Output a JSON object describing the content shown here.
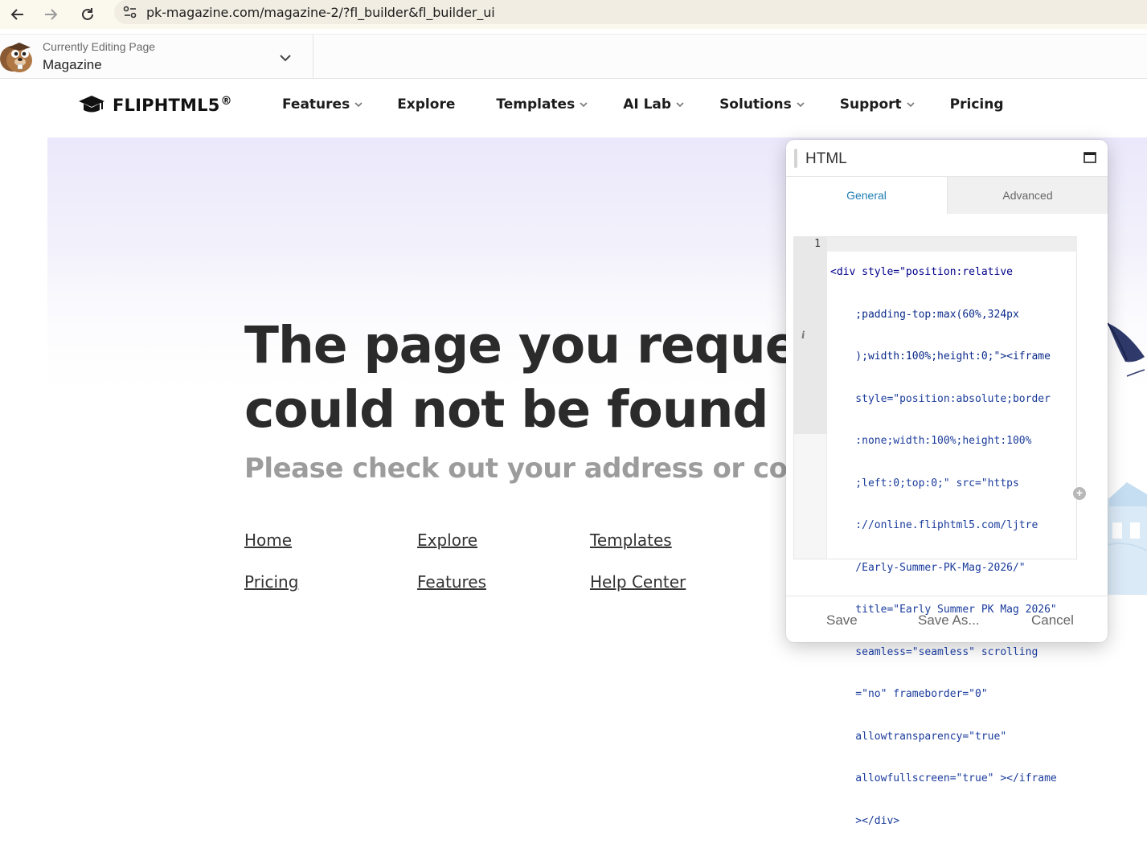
{
  "browser": {
    "url": "pk-magazine.com/magazine-2/?fl_builder&fl_builder_ui"
  },
  "builder_bar": {
    "label": "Currently Editing Page",
    "page_name": "Magazine"
  },
  "site": {
    "brand": "FLIPHTML5",
    "brand_mark": "®",
    "nav": [
      {
        "label": "Features",
        "has_dropdown": true
      },
      {
        "label": "Explore",
        "has_dropdown": false
      },
      {
        "label": "Templates",
        "has_dropdown": true
      },
      {
        "label": "AI Lab",
        "has_dropdown": true
      },
      {
        "label": "Solutions",
        "has_dropdown": true
      },
      {
        "label": "Support",
        "has_dropdown": true
      },
      {
        "label": "Pricing",
        "has_dropdown": false
      }
    ]
  },
  "hero": {
    "headline_line1": "The page you requested",
    "headline_line2": "could not be found",
    "subline": "Please check out your address or contact us",
    "links": [
      "Home",
      "Explore",
      "Templates",
      "Pricing",
      "Features",
      "Help Center"
    ]
  },
  "panel": {
    "title": "HTML",
    "tabs": [
      {
        "label": "General",
        "active": true
      },
      {
        "label": "Advanced",
        "active": false
      }
    ],
    "line_number": "1",
    "code_lines": [
      "<div style=\"position:relative",
      "    ;padding-top:max(60%,324px",
      "    );width:100%;height:0;\"><iframe",
      "    style=\"position:absolute;border",
      "    :none;width:100%;height:100%",
      "    ;left:0;top:0;\" src=\"https",
      "    ://online.fliphtml5.com/ljtre",
      "    /Early-Summer-PK-Mag-2026/\"",
      "    title=\"Early Summer PK Mag 2026\"",
      "    seamless=\"seamless\" scrolling",
      "    =\"no\" frameborder=\"0\"",
      "    allowtransparency=\"true\"",
      "    allowfullscreen=\"true\" ></iframe",
      "    ></div>"
    ],
    "buttons": {
      "save": "Save",
      "save_as": "Save As...",
      "cancel": "Cancel"
    }
  },
  "colors": {
    "accent": "#1f7db5",
    "headline": "#2b2b2b",
    "subline": "#9c9c9c"
  }
}
